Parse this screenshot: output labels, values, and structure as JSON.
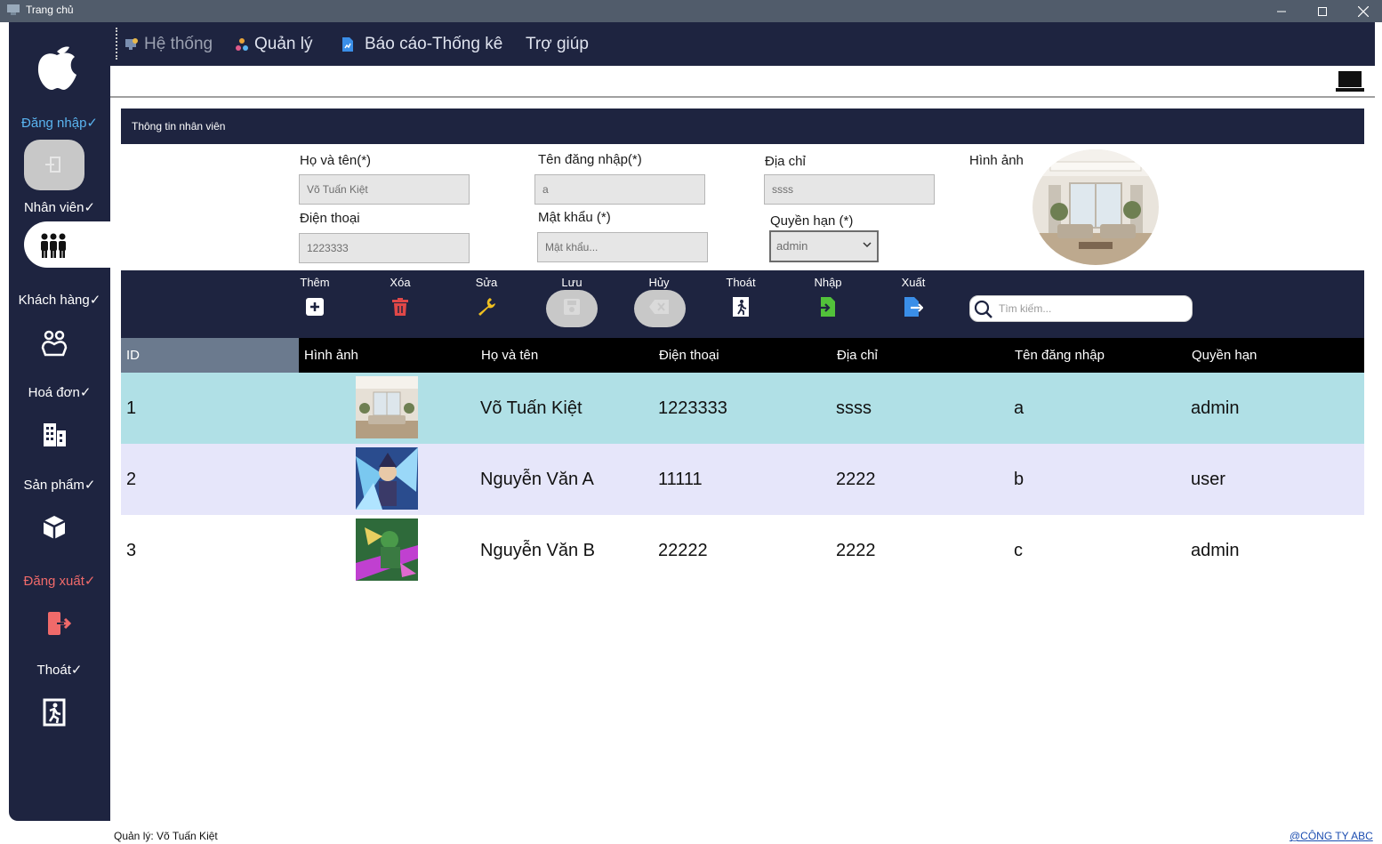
{
  "window": {
    "title": "Trang chủ"
  },
  "sidebar": {
    "items": [
      {
        "label": "Đăng nhập✓",
        "icon": "login-icon"
      },
      {
        "label": "Nhân viên✓",
        "icon": "staff-icon"
      },
      {
        "label": "Khách hàng✓",
        "icon": "customer-icon"
      },
      {
        "label": "Hoá đơn✓",
        "icon": "invoice-icon"
      },
      {
        "label": "Sản phẩm✓",
        "icon": "product-icon"
      },
      {
        "label": "Đăng xuất✓",
        "icon": "logout-icon"
      },
      {
        "label": "Thoát✓",
        "icon": "exit-icon"
      }
    ]
  },
  "menu": {
    "system": "Hệ thống",
    "manage": "Quản lý",
    "report": "Báo cáo-Thống kê",
    "help": "Trợ giúp"
  },
  "info": {
    "header": "Thông tin nhân viên",
    "fullname_label": "Họ và tên(*)",
    "fullname_value": "Võ Tuấn Kiệt",
    "username_label": "Tên đăng nhập(*)",
    "username_value": "a",
    "address_label": "Địa chỉ",
    "address_value": "ssss",
    "image_label": "Hình ảnh",
    "phone_label": "Điện thoại",
    "phone_value": "1223333",
    "password_label": "Mật khẩu (*)",
    "password_placeholder": "Mật khẩu...",
    "role_label": "Quyền hạn (*)",
    "role_value": "admin"
  },
  "actions": {
    "add": "Thêm",
    "delete": "Xóa",
    "edit": "Sửa",
    "save": "Lưu",
    "cancel": "Hủy",
    "exit": "Thoát",
    "import": "Nhập",
    "export": "Xuất",
    "search_placeholder": "Tìm kiếm..."
  },
  "table": {
    "columns": [
      "ID",
      "Hình ảnh",
      "Họ và tên",
      "Điện thoại",
      "Địa chỉ",
      "Tên đăng nhập",
      "Quyền hạn"
    ],
    "rows": [
      {
        "id": "1",
        "name": "Võ Tuấn Kiệt",
        "phone": "1223333",
        "address": "ssss",
        "username": "a",
        "role": "admin"
      },
      {
        "id": "2",
        "name": "Nguyễn Văn A",
        "phone": "11111",
        "address": "2222",
        "username": "b",
        "role": "user"
      },
      {
        "id": "3",
        "name": "Nguyễn Văn B",
        "phone": "22222",
        "address": "2222",
        "username": "c",
        "role": "admin"
      }
    ]
  },
  "status": {
    "manager": "Quản lý: Võ Tuấn Kiệt",
    "company": "@CÔNG TY ABC"
  },
  "colors": {
    "navy": "#1e2440",
    "row_selected": "#b0e0e6",
    "row_alt": "#e6e6fa"
  }
}
